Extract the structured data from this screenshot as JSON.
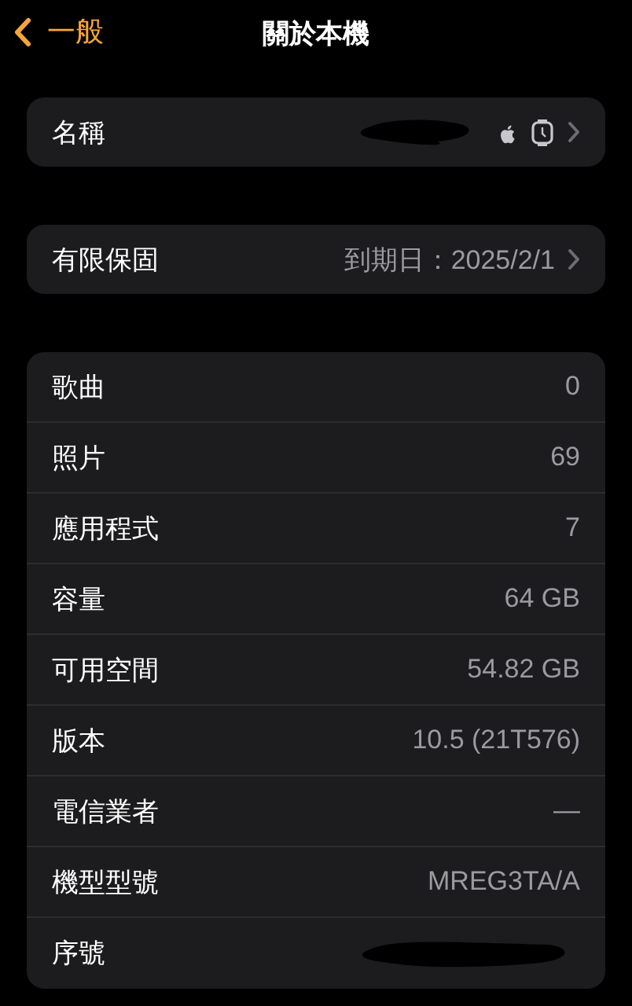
{
  "nav": {
    "back": "一般",
    "title": "關於本機"
  },
  "groups": [
    {
      "rows": [
        {
          "label": "名稱",
          "kind": "device",
          "chevron": true
        }
      ]
    },
    {
      "rows": [
        {
          "label": "有限保固",
          "kind": "text",
          "value": "到期日：2025/2/1",
          "chevron": true
        }
      ]
    },
    {
      "rows": [
        {
          "label": "歌曲",
          "kind": "text",
          "value": "0",
          "chevron": false
        },
        {
          "label": "照片",
          "kind": "text",
          "value": "69",
          "chevron": false
        },
        {
          "label": "應用程式",
          "kind": "text",
          "value": "7",
          "chevron": false
        },
        {
          "label": "容量",
          "kind": "text",
          "value": "64 GB",
          "chevron": false
        },
        {
          "label": "可用空間",
          "kind": "text",
          "value": "54.82 GB",
          "chevron": false
        },
        {
          "label": "版本",
          "kind": "text",
          "value": "10.5 (21T576)",
          "chevron": false
        },
        {
          "label": "電信業者",
          "kind": "text",
          "value": "—",
          "chevron": false
        },
        {
          "label": "機型型號",
          "kind": "text",
          "value": "MREG3TA/A",
          "chevron": false
        },
        {
          "label": "序號",
          "kind": "redacted",
          "chevron": false
        }
      ]
    }
  ]
}
